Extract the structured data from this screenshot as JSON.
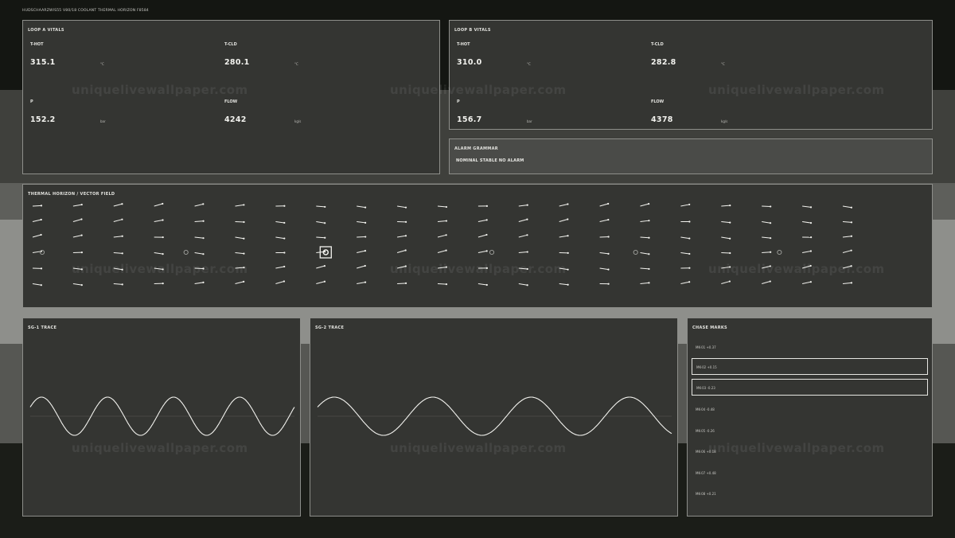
{
  "header": {
    "title": "HUDSCHAARZWIS55  V80/18  COOLANT THERMAL HORIZON  F8584"
  },
  "loop_a": {
    "title": "LOOP A  VITALS",
    "metrics": [
      {
        "label": "T-HOT",
        "value": "315.1",
        "unit": "°C"
      },
      {
        "label": "T-CLD",
        "value": "280.1",
        "unit": "°C"
      },
      {
        "label": "P",
        "value": "152.2",
        "unit": "bar"
      },
      {
        "label": "FLOW",
        "value": "4242",
        "unit": "kg/s"
      }
    ]
  },
  "loop_b": {
    "title": "LOOP B  VITALS",
    "metrics": [
      {
        "label": "T-HOT",
        "value": "310.0",
        "unit": "°C"
      },
      {
        "label": "T-CLD",
        "value": "282.8",
        "unit": "°C"
      },
      {
        "label": "P",
        "value": "156.7",
        "unit": "bar"
      },
      {
        "label": "FLOW",
        "value": "4378",
        "unit": "kg/s"
      }
    ]
  },
  "alarm": {
    "title": "ALARM GRAMMAR",
    "status": "NOMINAL  STABLE  NO ALARM"
  },
  "vector_field": {
    "title": "THERMAL HORIZON  /  VECTOR FIELD",
    "columns": 21,
    "rows": 6,
    "selected_probe_column": 7
  },
  "sg1": {
    "title": "SG-1 TRACE",
    "cycles": 4
  },
  "sg2": {
    "title": "SG-2 TRACE",
    "cycles": 3.6
  },
  "chase": {
    "title": "CHASE MARKS",
    "marks": [
      {
        "label": "MK-01  +0.37",
        "selected": false
      },
      {
        "label": "MK-02  +0.15",
        "selected": true
      },
      {
        "label": "MK-03  -0.23",
        "selected": true
      },
      {
        "label": "MK-04  -0.48",
        "selected": false
      },
      {
        "label": "MK-05  -0.26",
        "selected": false
      },
      {
        "label": "MK-06  +0.18",
        "selected": false
      },
      {
        "label": "MK-07  +0.48",
        "selected": false
      },
      {
        "label": "MK-08  +0.21",
        "selected": false
      }
    ]
  },
  "watermark": "uniquelivewallpaper.com",
  "colors": {
    "line": "#f2f2ee",
    "panel": "#343532",
    "border": "#8d8e8a"
  }
}
